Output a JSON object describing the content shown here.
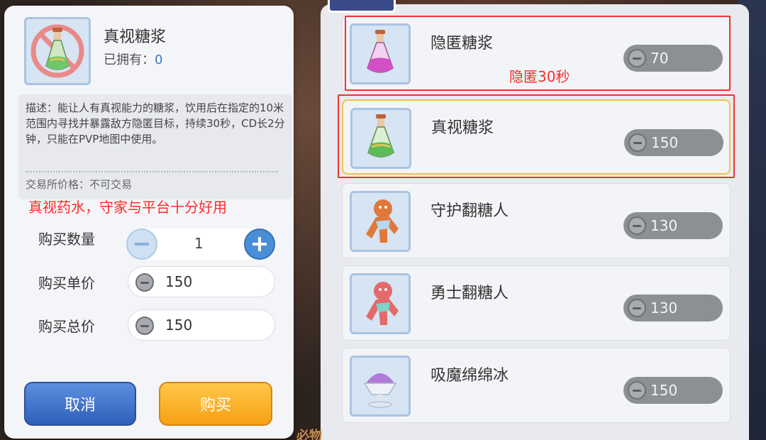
{
  "detail": {
    "item_name": "真视糖浆",
    "owned_label": "已拥有：",
    "owned_value": "0",
    "description": "描述：能让人有真视能力的糖浆，饮用后在指定的10米范围内寻找并暴露敌方隐匿目标，持续30秒，CD长2分钟，只能在PVP地图中使用。",
    "trade_label": "交易所价格：",
    "trade_value": "不可交易",
    "note": "真视药水，守家与平台十分好用",
    "quantity_label": "购买数量",
    "quantity_value": "1",
    "unit_price_label": "购买单价",
    "unit_price_value": "150",
    "total_price_label": "购买总价",
    "total_price_value": "150",
    "cancel_label": "取消",
    "buy_label": "购买"
  },
  "shop": {
    "items": [
      {
        "name": "隐匿糖浆",
        "price": "70",
        "icon": "pink-potion-icon"
      },
      {
        "name": "真视糖浆",
        "price": "150",
        "icon": "green-potion-icon"
      },
      {
        "name": "守护翻糖人",
        "price": "130",
        "icon": "gingerbread-icon"
      },
      {
        "name": "勇士翻糖人",
        "price": "130",
        "icon": "gingerbread-icon"
      },
      {
        "name": "吸魔绵绵冰",
        "price": "150",
        "icon": "shaved-ice-icon"
      }
    ],
    "note_hidden": "隐匿30秒"
  },
  "background": {
    "bottom_text": "必物"
  },
  "colors": {
    "note_red": "#ff2a2a",
    "cancel_blue": "#2c5fb8",
    "buy_orange": "#f5a014",
    "price_pill": "#8c8f94",
    "panel": "#f4f5f8"
  }
}
